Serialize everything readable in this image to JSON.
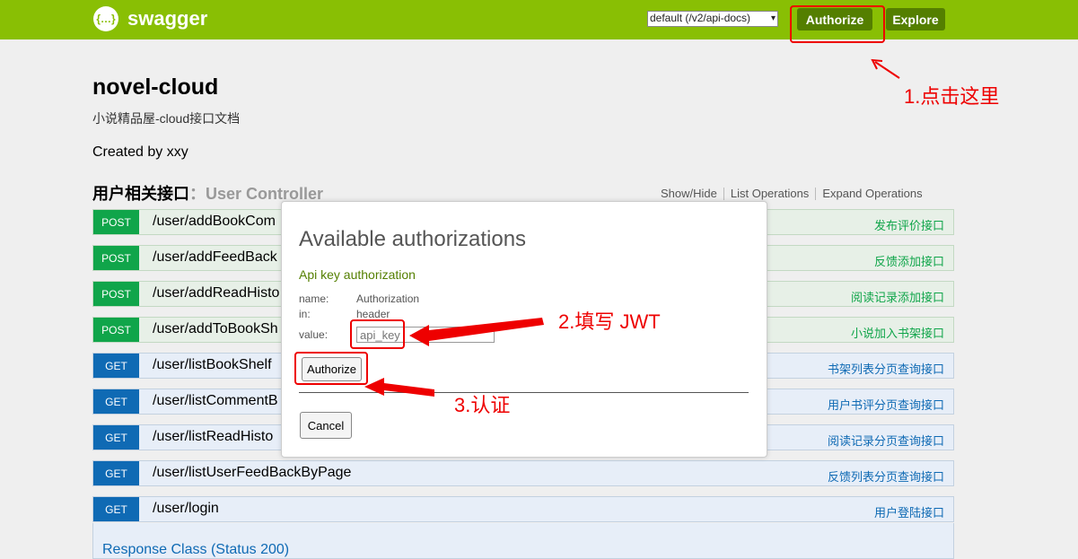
{
  "header": {
    "logo_glyph": "{…}",
    "brand": "swagger",
    "api_selector": "default (/v2/api-docs)",
    "authorize_label": "Authorize",
    "explore_label": "Explore",
    "bar_color": "#89bf04",
    "button_color": "#547f00"
  },
  "info": {
    "title": "novel-cloud",
    "description": "小说精品屋-cloud接口文档",
    "created_by": "Created by xxy"
  },
  "resource": {
    "name": "用户相关接口",
    "separator": "：",
    "controller": "User Controller",
    "actions": [
      "Show/Hide",
      "List Operations",
      "Expand Operations"
    ]
  },
  "operations": [
    {
      "method": "POST",
      "path": "/user/addBookCom",
      "summary": "发布评价接口"
    },
    {
      "method": "POST",
      "path": "/user/addFeedBack",
      "summary": "反馈添加接口"
    },
    {
      "method": "POST",
      "path": "/user/addReadHisto",
      "summary": "阅读记录添加接口"
    },
    {
      "method": "POST",
      "path": "/user/addToBookSh",
      "summary": "小说加入书架接口"
    },
    {
      "method": "GET",
      "path": "/user/listBookShelf",
      "summary": "书架列表分页查询接口"
    },
    {
      "method": "GET",
      "path": "/user/listCommentB",
      "summary": "用户书评分页查询接口"
    },
    {
      "method": "GET",
      "path": "/user/listReadHisto",
      "summary": "阅读记录分页查询接口"
    },
    {
      "method": "GET",
      "path": "/user/listUserFeedBackByPage",
      "summary": "反馈列表分页查询接口"
    },
    {
      "method": "GET",
      "path": "/user/login",
      "summary": "用户登陆接口"
    }
  ],
  "expanded": {
    "response_class": "Response Class (Status 200)"
  },
  "modal": {
    "title": "Available authorizations",
    "subtitle": "Api key authorization",
    "name_label": "name:",
    "name_value": "Authorization",
    "in_label": "in:",
    "in_value": "header",
    "value_label": "value:",
    "value_placeholder": "api_key",
    "authorize_label": "Authorize",
    "cancel_label": "Cancel"
  },
  "annotations": {
    "step1": "1.点击这里",
    "step2": "2.填写 JWT",
    "step3": "3.认证",
    "color": "#e00"
  }
}
